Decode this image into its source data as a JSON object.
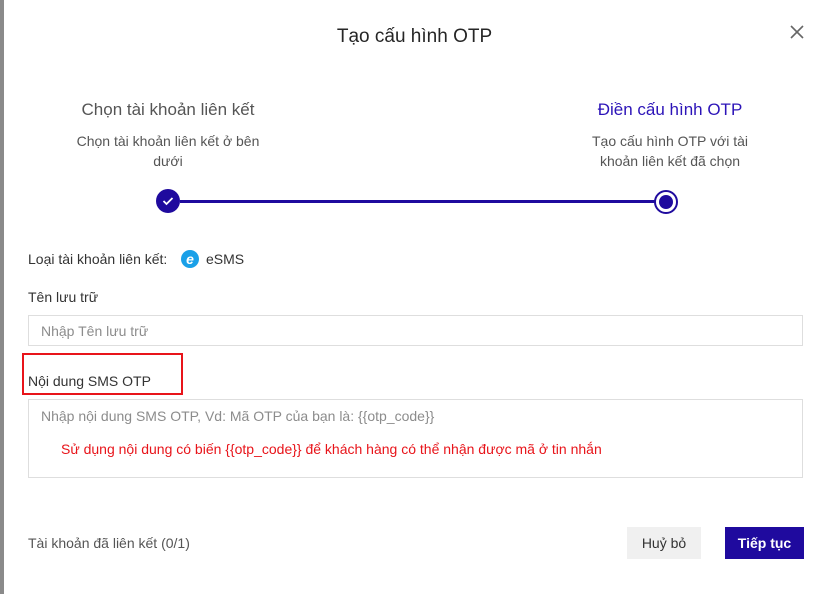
{
  "dialog": {
    "title": "Tạo cấu hình OTP"
  },
  "steps": [
    {
      "title": "Chọn tài khoản liên kết",
      "description_line1": "Chọn tài khoản liên kết ở bên",
      "description_line2": "dưới",
      "status": "done"
    },
    {
      "title": "Điền cấu hình OTP",
      "description_line1": "Tạo cấu hình OTP với tài",
      "description_line2": "khoản liên kết đã chọn",
      "status": "current"
    }
  ],
  "form": {
    "account_type_label": "Loại tài khoản liên kết:",
    "account_type_icon": "e",
    "account_type_value": "eSMS",
    "storage_name_label": "Tên lưu trữ",
    "storage_name_placeholder": "Nhập Tên lưu trữ",
    "storage_name_value": "",
    "sms_content_label": "Nội dung SMS OTP",
    "sms_content_placeholder": "Nhập nội dung SMS OTP, Vd: Mã OTP của bạn là: {{otp_code}}",
    "sms_content_hint": "Sử dụng nội dung có biến {{otp_code}} để khách hàng có thể nhận được mã ở tin nhắn"
  },
  "footer": {
    "linked_accounts": "Tài khoản đã liên kết (0/1)",
    "cancel_label": "Huỷ bỏ",
    "next_label": "Tiếp tục"
  },
  "colors": {
    "primary": "#1f0a9e",
    "highlight": "#e8141a",
    "esms_icon": "#1aa0e8"
  }
}
